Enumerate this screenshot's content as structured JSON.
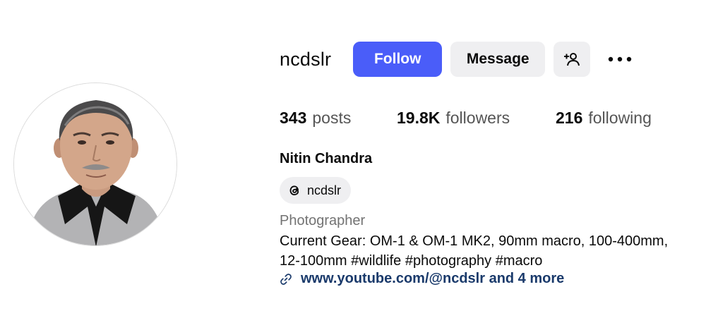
{
  "profile": {
    "username": "ncdslr",
    "full_name": "Nitin Chandra",
    "category": "Photographer",
    "bio_line1": "Current Gear: OM-1 & OM-1 MK2, 90mm macro, 100-400mm,",
    "bio_line2": "12-100mm #wildlife #photography #macro",
    "link_text": "www.youtube.com/@ncdslr and 4 more",
    "threads_handle": "ncdslr"
  },
  "actions": {
    "follow_label": "Follow",
    "message_label": "Message",
    "add_user_icon": "add-user-icon",
    "more_icon": "more-options-icon"
  },
  "stats": {
    "posts_count": "343",
    "posts_label": "posts",
    "followers_count": "19.8K",
    "followers_label": "followers",
    "following_count": "216",
    "following_label": "following"
  },
  "colors": {
    "follow_button": "#4a5df9",
    "secondary_button": "#efeff1",
    "link": "#1a3a6b"
  }
}
